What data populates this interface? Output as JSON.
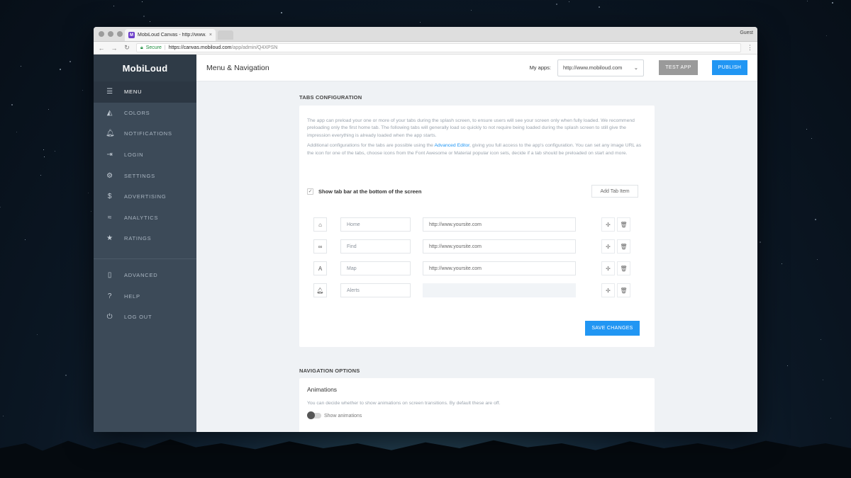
{
  "browser": {
    "tab_title": "MobiLoud Canvas - http://www.",
    "tab_close": "×",
    "favicon_letter": "M",
    "profile": "Guest",
    "secure_label": "Secure",
    "url_host": "https://canvas.mobiloud.com",
    "url_path": "/app/admin/Q4XPSN"
  },
  "sidebar": {
    "logo": "MobiLoud",
    "items": [
      {
        "label": "MENU",
        "icon": "hamburger-icon",
        "glyph": "☰",
        "active": true
      },
      {
        "label": "COLORS",
        "icon": "paint-bucket-icon",
        "glyph": "◭"
      },
      {
        "label": "NOTIFICATIONS",
        "icon": "bell-icon",
        "glyph": "🔔︎"
      },
      {
        "label": "LOGIN",
        "icon": "login-icon",
        "glyph": "⇥"
      },
      {
        "label": "SETTINGS",
        "icon": "gear-icon",
        "glyph": "⚙"
      },
      {
        "label": "ADVERTISING",
        "icon": "dollar-icon",
        "glyph": "$"
      },
      {
        "label": "ANALYTICS",
        "icon": "trend-icon",
        "glyph": "≈"
      },
      {
        "label": "RATINGS",
        "icon": "star-icon",
        "glyph": "★"
      }
    ],
    "bottom_items": [
      {
        "label": "ADVANCED",
        "icon": "phone-icon",
        "glyph": "▯"
      },
      {
        "label": "HELP",
        "icon": "help-icon",
        "glyph": "?"
      },
      {
        "label": "LOG OUT",
        "icon": "power-icon",
        "glyph": "⏻"
      }
    ]
  },
  "header": {
    "title": "Menu & Navigation",
    "myapps_label": "My apps:",
    "selected_app": "http://www.mobiloud.com",
    "test_app": "TEST APP",
    "publish": "PUBLISH"
  },
  "tabs_config": {
    "heading": "TABS CONFIGURATION",
    "para1": "The app can preload your one or more of your tabs during the splash screen, to ensure users will see your screen only when fully loaded. We recommend preloading only the first home tab. The following tabs will generally load so quickly to not require being loaded during the splash screen to still give the impression everything is already loaded when the app starts.",
    "para2_before": "Additional configurations for the tabs are possible using the ",
    "para2_link": "Advanced Editor",
    "para2_after": ", giving you full access to the app's configuration. You can set any image URL as the icon for one of the tabs, choose icons from the Font Awesome or Material popular icon sets, decide if a tab should be preloaded on start and more.",
    "show_tabbar_label": "Show tab bar at the bottom of the screen",
    "add_tab": "Add Tab Item",
    "save": "SAVE CHANGES",
    "rows": [
      {
        "icon": "home-icon",
        "glyph": "⌂",
        "name": "Home",
        "url": "http://www.yoursite.com"
      },
      {
        "icon": "binoculars-icon",
        "glyph": "∞",
        "name": "Find",
        "url": "http://www.yoursite.com"
      },
      {
        "icon": "map-font-icon",
        "glyph": "A",
        "name": "Map",
        "url": "http://www.yoursite.com"
      },
      {
        "icon": "bell-icon",
        "glyph": "🔔︎",
        "name": "Alerts",
        "url": ""
      }
    ],
    "move_glyph": "✢",
    "trash_glyph": "🗑︎"
  },
  "nav_options": {
    "heading": "NAVIGATION OPTIONS",
    "animations_title": "Animations",
    "animations_desc": "You can decide whether to show animations on screen transitions. By default these are off.",
    "show_animations_label": "Show animations"
  }
}
